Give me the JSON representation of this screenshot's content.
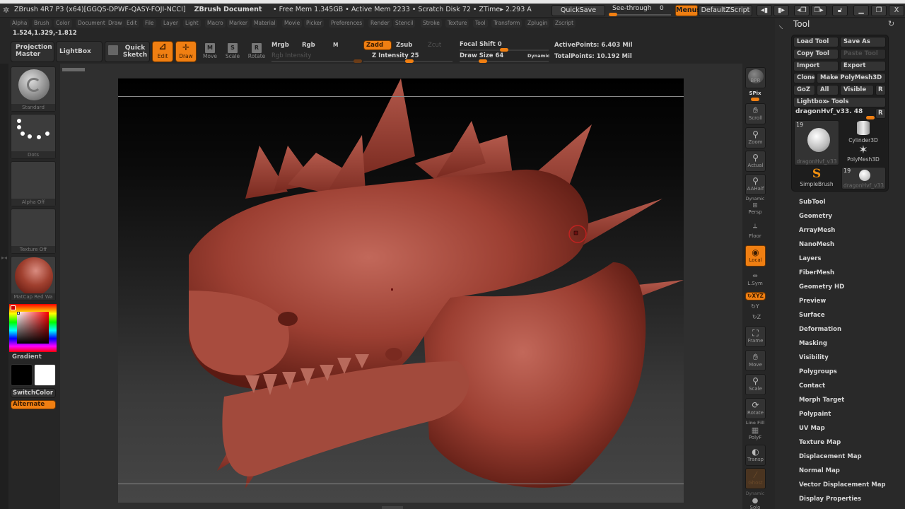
{
  "window": {
    "title": "ZBrush 4R7 P3 (x64)[GGQS-DPWF-QASY-FOJI-NCCI]",
    "document": "ZBrush Document",
    "status": "• Free Mem 1.345GB • Active Mem 2233 • Scratch Disk 72 • ZTime▸ 2.293 A",
    "quicksave": "QuickSave",
    "seethrough_label": "See-through",
    "seethrough_value": "0",
    "seethrough_fraction": 0.0,
    "menus_label": "Menus",
    "zscript_label": "DefaultZScript",
    "icons": [
      "shrink-left-icon",
      "expand-right-icon",
      "tile-left-icon",
      "tile-right-icon",
      "lock-icon",
      "minimize-icon",
      "restore-icon",
      "close-icon"
    ],
    "close_glyph": "X"
  },
  "menubar": [
    "Alpha",
    "Brush",
    "Color",
    "Document",
    "Draw",
    "Edit",
    "File",
    "Layer",
    "Light",
    "Macro",
    "Marker",
    "Material",
    "Movie",
    "Picker",
    "Preferences",
    "Render",
    "Stencil",
    "Stroke",
    "Texture",
    "Tool",
    "Transform",
    "Zplugin",
    "Zscript"
  ],
  "coords": "1.524,1.329,-1.812",
  "toolbar": {
    "projection_master": "Projection Master",
    "lightbox": "LightBox",
    "quick_sketch": "Quick Sketch",
    "edit": "Edit",
    "draw": "Draw",
    "move": "Move",
    "scale": "Scale",
    "rotate": "Rotate",
    "move_key": "M",
    "scale_key": "S",
    "rotate_key": "R",
    "mrgb": "Mrgb",
    "rgb": "Rgb",
    "m": "M",
    "rgb_intensity": "Rgb Intensity",
    "zadd": "Zadd",
    "zsub": "Zsub",
    "zcut": "Zcut",
    "z_intensity_label": "Z Intensity",
    "z_intensity": "25",
    "focal_shift_label": "Focal Shift",
    "focal_shift": "0",
    "draw_size_label": "Draw Size",
    "draw_size": "64",
    "dynamic": "Dynamic",
    "active_points": "ActivePoints: 6.403 Mil",
    "total_points": "TotalPoints: 10.192 Mil"
  },
  "left_shelf": {
    "brush": "Standard",
    "stroke": "Dots",
    "alpha": "Alpha Off",
    "texture": "Texture Off",
    "material": "MatCap Red Wa",
    "gradient": "Gradient",
    "switch_color": "SwitchColor",
    "alternate": "Alternate",
    "main_color": "#000000",
    "secondary_color": "#ffffff"
  },
  "right_shelf": {
    "bpr": "BPR",
    "spix": "SPix",
    "scroll": "Scroll",
    "zoom": "Zoom",
    "actual": "Actual",
    "aahalf": "AAHalf",
    "dynamic": "Dynamic",
    "persp": "Persp",
    "floor": "Floor",
    "local": "Local",
    "lsym": "L.Sym",
    "xyz": "XYZ",
    "y": "Y",
    "z": "Z",
    "frame": "Frame",
    "move": "Move",
    "scale": "Scale",
    "rotate": "Rotate",
    "line_fill": "Line Fill",
    "polyf": "PolyF",
    "transp": "Transp",
    "ghost": "Ghost",
    "dynamic2": "Dynamic",
    "solo": "Solo"
  },
  "tool_panel": {
    "title": "Tool",
    "load_tool": "Load Tool",
    "save_as": "Save As",
    "copy_tool": "Copy Tool",
    "paste_tool": "Paste Tool",
    "import": "Import",
    "export": "Export",
    "clone": "Clone",
    "make_polymesh": "Make PolyMesh3D",
    "goz": "GoZ",
    "all": "All",
    "visible": "Visible",
    "r": "R",
    "lightbox_tools": "Lightbox▸ Tools",
    "current_tool": "dragonHvf_v33. 48",
    "thumbs": [
      {
        "label": "dragonHvf_v33",
        "count": "19"
      },
      {
        "label": "Cylinder3D"
      },
      {
        "label": "PolyMesh3D"
      },
      {
        "label": "SimpleBrush"
      },
      {
        "label": "dragonHvf_v33",
        "count": "19"
      }
    ],
    "sections": [
      "SubTool",
      "Geometry",
      "ArrayMesh",
      "NanoMesh",
      "Layers",
      "FiberMesh",
      "Geometry HD",
      "Preview",
      "Surface",
      "Deformation",
      "Masking",
      "Visibility",
      "Polygroups",
      "Contact",
      "Morph Target",
      "Polypaint",
      "UV Map",
      "Texture Map",
      "Displacement Map",
      "Normal Map",
      "Vector Displacement Map",
      "Display Properties"
    ]
  },
  "colors": {
    "accent": "#f07f12",
    "model": "#9c3f32"
  }
}
